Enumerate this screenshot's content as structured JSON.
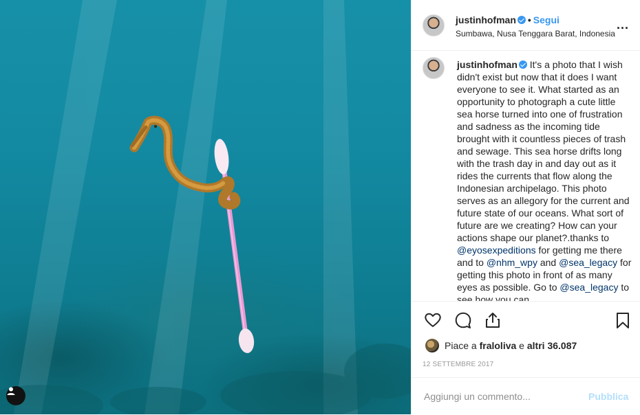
{
  "post": {
    "author": "justinhofman",
    "follow_label": "Segui",
    "location": "Sumbawa, Nusa Tenggara Barat, Indonesia",
    "more_label": "..."
  },
  "caption": {
    "author": "justinhofman",
    "text_1": "It's a photo that I wish didn't exist but now that it does I want everyone to see it. What started as an opportunity to photograph a cute little sea horse turned into one of frustration and sadness as the incoming tide brought with it countless pieces of trash and sewage. This sea horse drifts long with the trash day in and day out as it rides the currents that flow along the Indonesian archipelago. This photo serves as an allegory for the current and future state of our oceans. What sort of future are we creating? How can your actions shape our planet?.thanks to ",
    "mention_1": "@eyosexpeditions",
    "text_2": " for getting me there and to ",
    "mention_2": "@nhm_wpy",
    "text_3": " and ",
    "mention_3": "@sea_legacy",
    "text_4": " for getting this photo in front of as many eyes as possible. Go to ",
    "mention_4": "@sea_legacy",
    "text_5": " to see how you can"
  },
  "actions": {
    "icons": [
      "heart-icon",
      "comment-icon",
      "share-icon",
      "bookmark-icon"
    ]
  },
  "likes": {
    "prefix": "Piace a ",
    "user": "fraloliva",
    "middle": " e ",
    "others": "altri 36.087"
  },
  "date": "12 SETTEMBRE 2017",
  "comment": {
    "placeholder": "Aggiungi un commento...",
    "post_label": "Pubblica"
  },
  "colors": {
    "accent": "#3897f0",
    "mention": "#003569",
    "water": "#138aa2"
  }
}
